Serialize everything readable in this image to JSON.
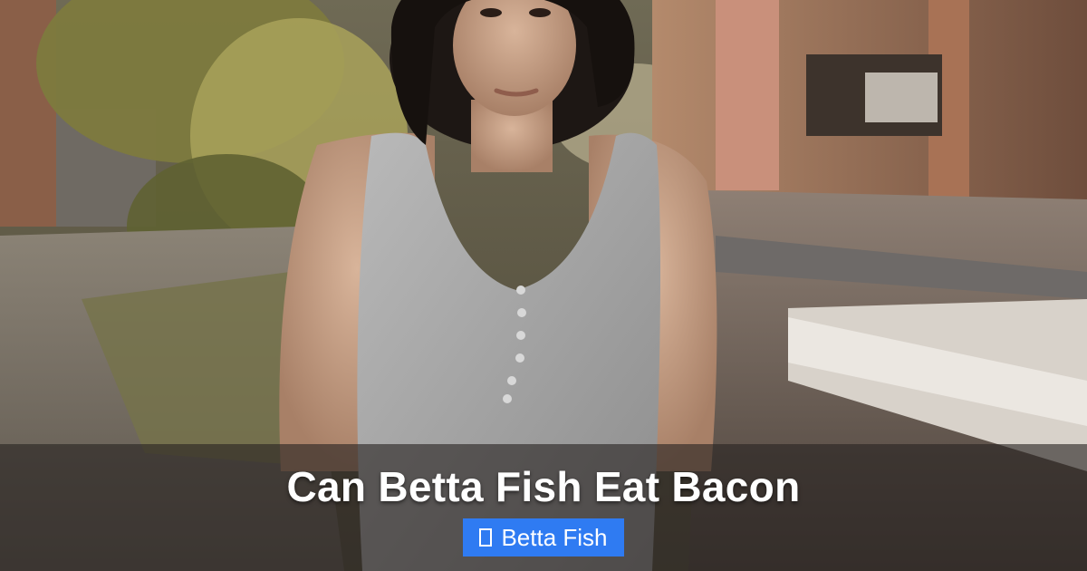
{
  "post": {
    "title": "Can Betta Fish Eat Bacon",
    "category": {
      "label": "Betta Fish",
      "icon": "tag-icon"
    }
  },
  "colors": {
    "badge_background": "#2f7bf2",
    "overlay": "rgba(40, 36, 34, 0.62)",
    "title_text": "#ffffff"
  }
}
